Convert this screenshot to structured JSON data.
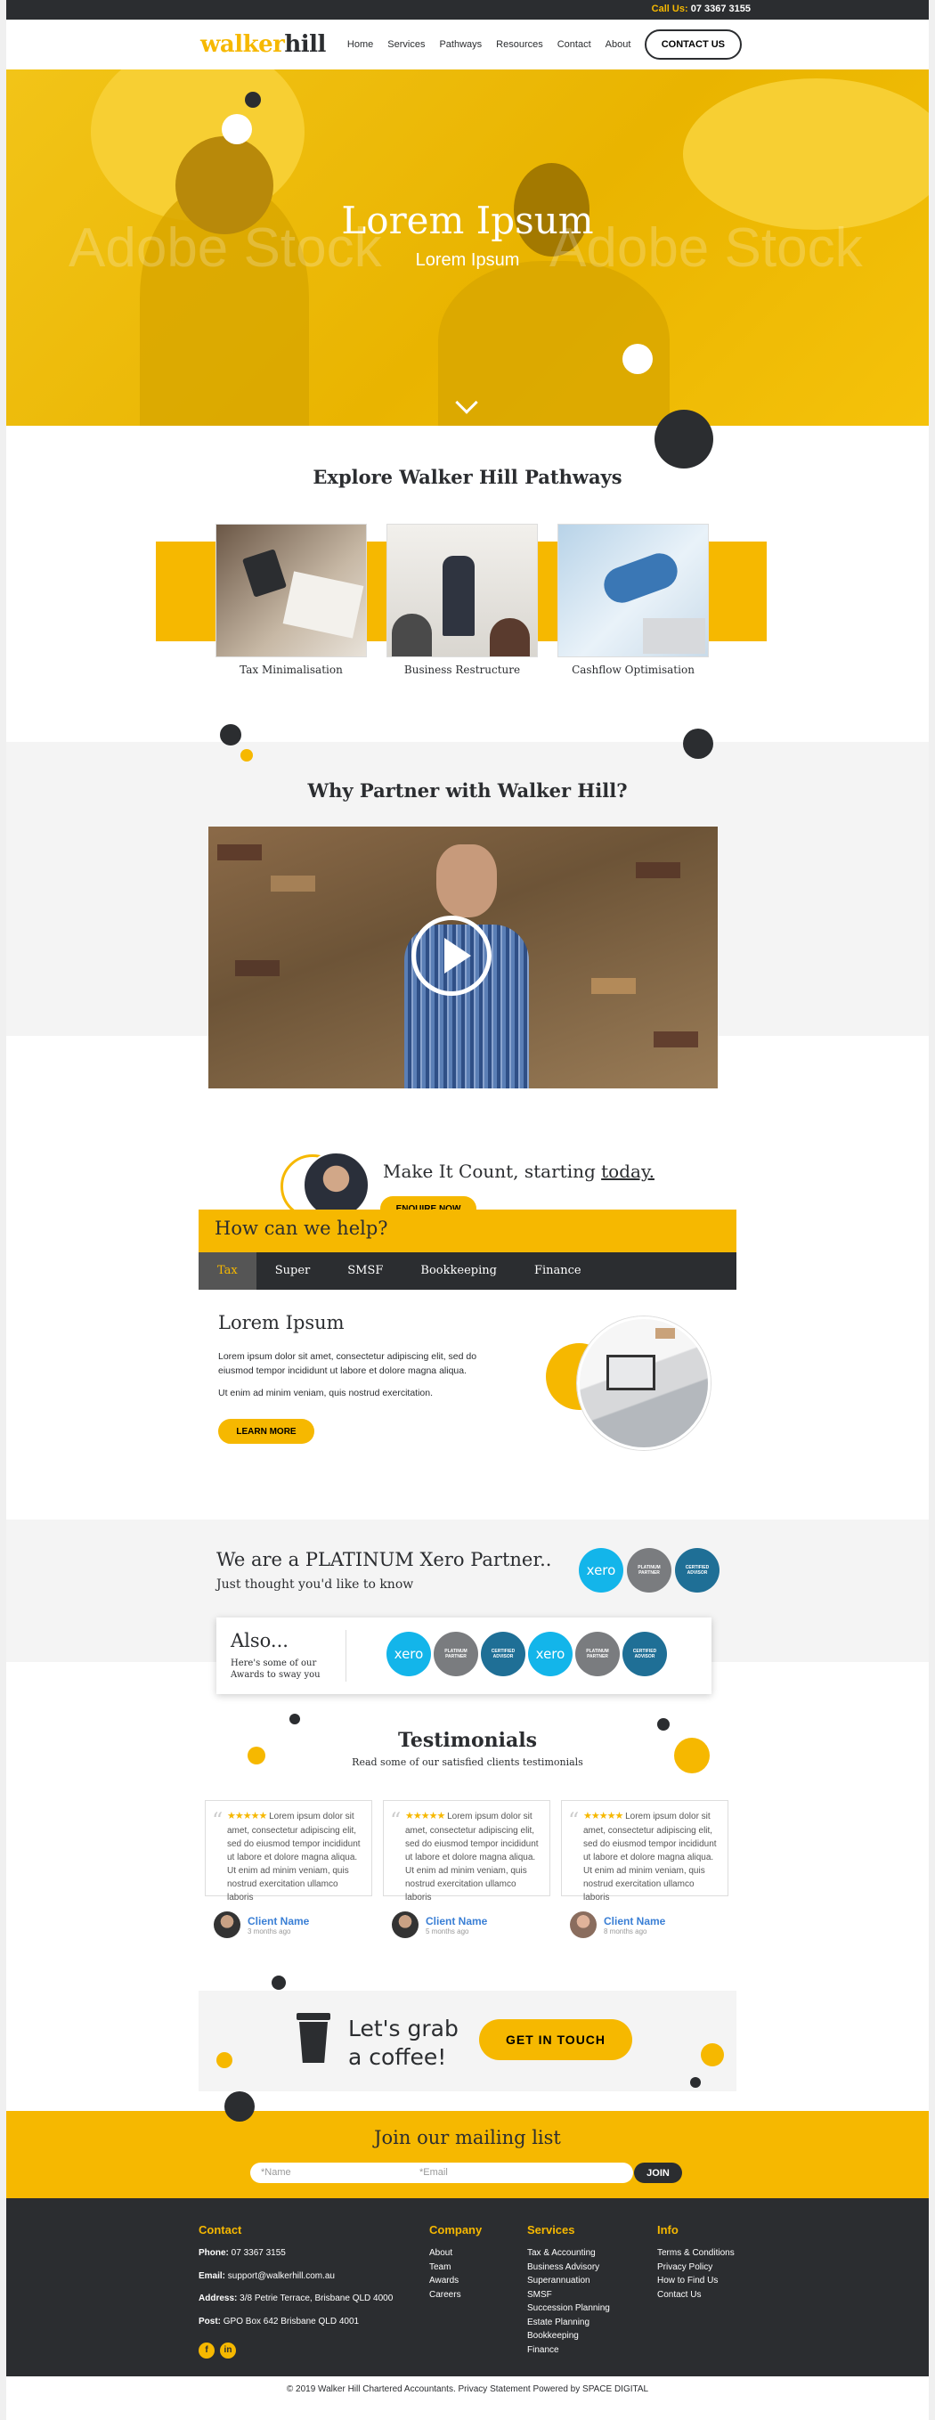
{
  "topbar": {
    "call_label": "Call Us:",
    "phone": "07 3367 3155"
  },
  "header": {
    "logo_walker": "walker",
    "logo_hill": "hill",
    "nav": [
      "Home",
      "Services",
      "Pathways",
      "Resources",
      "Contact",
      "About"
    ],
    "contact_button": "CONTACT US"
  },
  "hero": {
    "title": "Lorem Ipsum",
    "subtitle": "Lorem Ipsum",
    "watermark": "Adobe Stock"
  },
  "pathways": {
    "title": "Explore Walker Hill Pathways",
    "items": [
      {
        "label": "Tax Minimalisation"
      },
      {
        "label": "Business Restructure"
      },
      {
        "label": "Cashflow Optimisation"
      }
    ]
  },
  "why": {
    "title": "Why Partner with Walker Hill?"
  },
  "count": {
    "text": "Make It Count, starting ",
    "emphasis": "today.",
    "button": "ENQUIRE NOW"
  },
  "help": {
    "title": "How can we help?",
    "tabs": [
      "Tax",
      "Super",
      "SMSF",
      "Bookkeeping",
      "Finance"
    ],
    "active_tab": "Tax",
    "panel_title": "Lorem Ipsum",
    "para1": "Lorem ipsum dolor sit amet, consectetur adipiscing elit, sed do eiusmod tempor incididunt ut labore et dolore magna aliqua.",
    "para2": "Ut enim ad minim veniam, quis nostrud exercitation.",
    "button": "LEARN MORE"
  },
  "xero": {
    "title": "We are a PLATINUM Xero Partner..",
    "subtitle": "Just thought you'd like to know",
    "badge_xero": "xero",
    "badge_platinum": "PLATINUM PARTNER",
    "badge_certified": "CERTIFIED ADVISOR"
  },
  "also": {
    "title": "Also...",
    "text": "Here's some of our Awards to sway you"
  },
  "testimonials": {
    "title": "Testimonials",
    "subtitle": "Read some of our satisfied clients testimonials",
    "stars": "★★★★★",
    "items": [
      {
        "text": "Lorem ipsum dolor sit amet, consectetur adipiscing elit, sed do eiusmod tempor incididunt ut labore et dolore magna aliqua. Ut enim ad minim veniam, quis nostrud exercitation ullamco laboris",
        "name": "Client Name",
        "ago": "3 months ago"
      },
      {
        "text": "Lorem ipsum dolor sit amet, consectetur adipiscing elit, sed do eiusmod tempor incididunt ut labore et dolore magna aliqua. Ut enim ad minim veniam, quis nostrud exercitation ullamco laboris",
        "name": "Client Name",
        "ago": "5 months ago"
      },
      {
        "text": "Lorem ipsum dolor sit amet, consectetur adipiscing elit, sed do eiusmod tempor incididunt ut labore et dolore magna aliqua. Ut enim ad minim veniam, quis nostrud exercitation ullamco laboris",
        "name": "Client Name",
        "ago": "8 months ago"
      }
    ]
  },
  "coffee": {
    "line1": "Let's grab",
    "line2": "a coffee!",
    "button": "GET IN TOUCH"
  },
  "mailing": {
    "title": "Join our mailing list",
    "name_placeholder": "*Name",
    "email_placeholder": "*Email",
    "button": "JOIN"
  },
  "footer": {
    "contact_title": "Contact",
    "phone_label": "Phone:",
    "phone": "07 3367 3155",
    "email_label": "Email:",
    "email": "support@walkerhill.com.au",
    "address_label": "Address:",
    "address": "3/8 Petrie Terrace, Brisbane QLD 4000",
    "post_label": "Post:",
    "post": "GPO Box 642 Brisbane QLD 4001",
    "company_title": "Company",
    "company": [
      "About",
      "Team",
      "Awards",
      "Careers"
    ],
    "services_title": "Services",
    "services": [
      "Tax & Accounting",
      "Business Advisory",
      "Superannuation",
      "SMSF",
      "Succession Planning",
      "Estate Planning",
      "Bookkeeping",
      "Finance"
    ],
    "info_title": "Info",
    "info": [
      "Terms & Conditions",
      "Privacy Policy",
      "How to Find Us",
      "Contact Us"
    ],
    "facebook": "f",
    "linkedin": "in"
  },
  "copyright": "© 2019 Walker Hill Chartered Accountants. Privacy Statement Powered by SPACE DIGITAL",
  "colors": {
    "brand_yellow": "#f6b800",
    "dark": "#2b2d30",
    "link_blue": "#3a7fd5",
    "xero_blue": "#13b5ea"
  }
}
